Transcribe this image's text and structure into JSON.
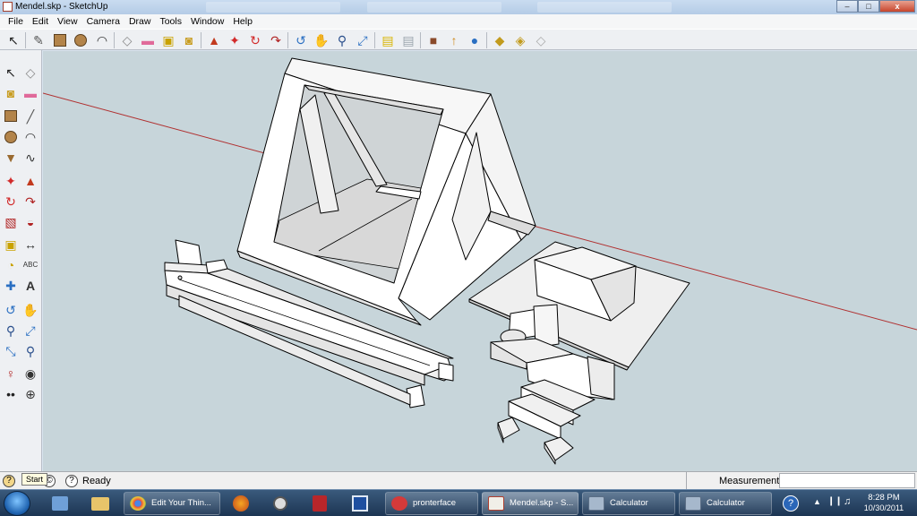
{
  "window": {
    "title": "Mendel.skp - SketchUp",
    "minimize": "–",
    "maximize": "□",
    "close": "x"
  },
  "menu": [
    "File",
    "Edit",
    "View",
    "Camera",
    "Draw",
    "Tools",
    "Window",
    "Help"
  ],
  "toolbar_icons": [
    "select-icon",
    "pencil-icon",
    "rectangle-icon",
    "circle-icon",
    "arc-icon",
    "make-component-icon",
    "eraser-icon",
    "tape-measure-icon",
    "paint-bucket-icon",
    "push-pull-icon",
    "move-icon",
    "rotate-icon",
    "follow-me-icon",
    "orbit-icon",
    "pan-icon",
    "zoom-icon",
    "zoom-extents-icon",
    "previous-view-icon",
    "next-view-icon",
    "get-models-icon",
    "share-model-icon",
    "google-earth-icon",
    "get-photo-texture-icon",
    "components-icon",
    "share-component-icon"
  ],
  "status": {
    "ready": "Ready",
    "tooltip": "Start",
    "measurements_label": "Measurements",
    "measurements_value": ""
  },
  "taskbar": {
    "tasks": [
      {
        "label": "Edit Your Thin...",
        "icon": "chrome-icon"
      },
      {
        "label": "pronterface",
        "icon": "pronterface-icon"
      },
      {
        "label": "Mendel.skp - S...",
        "icon": "sketchup-icon"
      },
      {
        "label": "Calculator",
        "icon": "calculator-icon"
      },
      {
        "label": "Calculator",
        "icon": "calculator-icon"
      }
    ],
    "time": "8:28 PM",
    "date": "10/30/2011"
  },
  "colors": {
    "viewport_bg": "#c7d5da",
    "face": "#ffffff",
    "shadow_face": "#dcdcdc",
    "edge": "#000000",
    "red_axis": "#b03030"
  }
}
